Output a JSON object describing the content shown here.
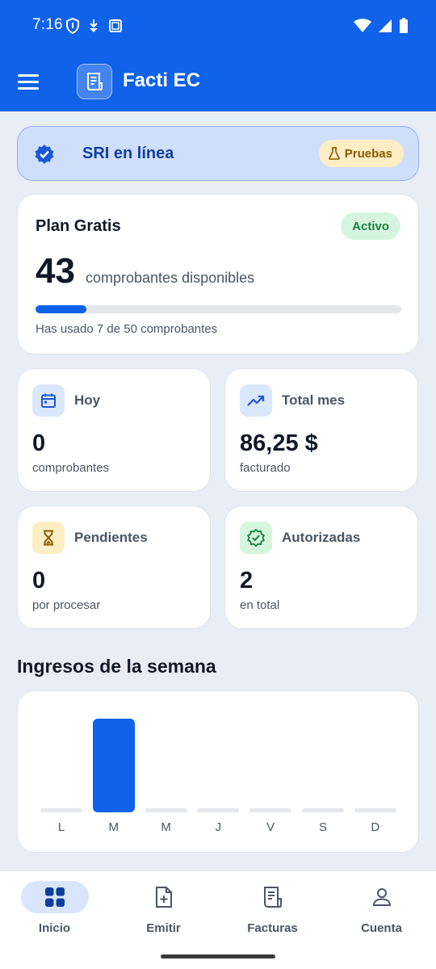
{
  "status_bar": {
    "time": "7:16"
  },
  "app_bar": {
    "title": "Facti EC"
  },
  "sri_banner": {
    "text": "SRI en línea",
    "badge": "Pruebas"
  },
  "plan": {
    "title": "Plan Gratis",
    "badge": "Activo",
    "count": "43",
    "count_label": "comprobantes disponibles",
    "usage_text": "Has usado 7 de 50 comprobantes",
    "progress_fraction": 0.14
  },
  "stats": [
    {
      "label": "Hoy",
      "value": "0",
      "sub": "comprobantes",
      "icon": "calendar-icon"
    },
    {
      "label": "Total mes",
      "value": "86,25 $",
      "sub": "facturado",
      "icon": "trending-up-icon"
    },
    {
      "label": "Pendientes",
      "value": "0",
      "sub": "por procesar",
      "icon": "hourglass-icon"
    },
    {
      "label": "Autorizadas",
      "value": "2",
      "sub": "en total",
      "icon": "verified-icon"
    }
  ],
  "weekly": {
    "title": "Ingresos de la semana",
    "chart_data": {
      "type": "bar",
      "categories": [
        "L",
        "M",
        "M",
        "J",
        "V",
        "S",
        "D"
      ],
      "values": [
        0,
        86.25,
        0,
        0,
        0,
        0,
        0
      ]
    }
  },
  "nav": [
    {
      "label": "Inicio",
      "icon": "grid-icon",
      "active": true
    },
    {
      "label": "Emitir",
      "icon": "add-document-icon",
      "active": false
    },
    {
      "label": "Facturas",
      "icon": "receipt-icon",
      "active": false
    },
    {
      "label": "Cuenta",
      "icon": "person-icon",
      "active": false
    }
  ],
  "colors": {
    "primary": "#0f62e9",
    "background": "#e9edf5",
    "success": "#17803d",
    "warning": "#8a5a00"
  }
}
